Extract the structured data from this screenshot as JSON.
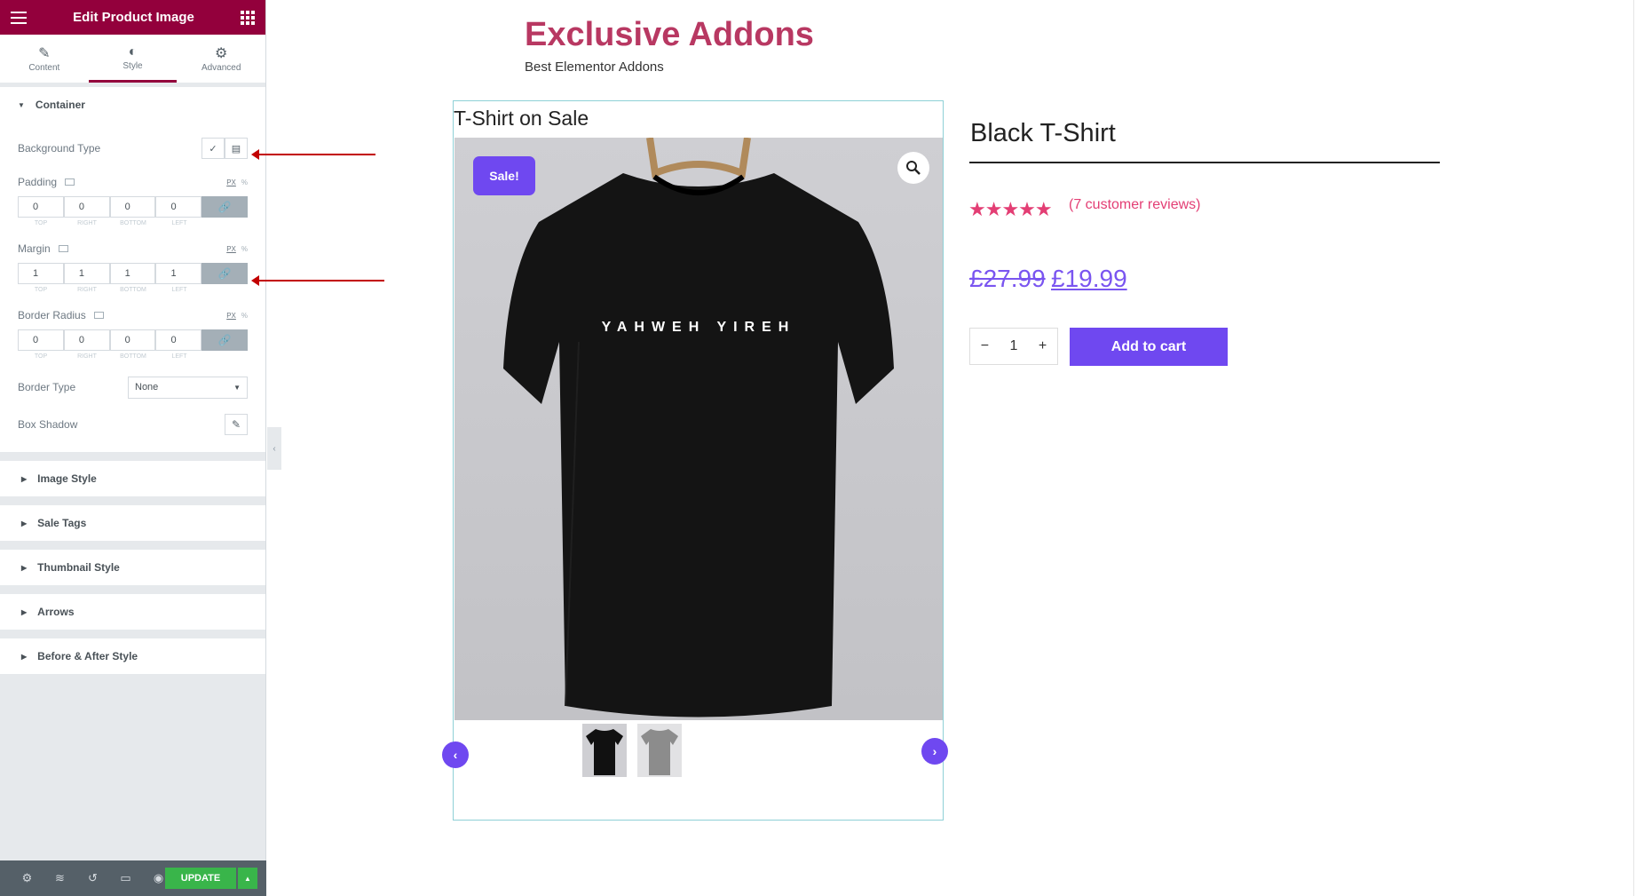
{
  "editor": {
    "title": "Edit Product Image",
    "tabs": [
      {
        "label": "Content",
        "icon": "pencil-icon"
      },
      {
        "label": "Style",
        "icon": "half-circle-icon"
      },
      {
        "label": "Advanced",
        "icon": "gear-icon"
      }
    ],
    "container": {
      "heading": "Container",
      "background_type": "Background Type",
      "padding": {
        "label": "Padding",
        "values": [
          "0",
          "0",
          "0",
          "0"
        ]
      },
      "margin": {
        "label": "Margin",
        "values": [
          "1",
          "1",
          "1",
          "1"
        ]
      },
      "border_radius": {
        "label": "Border Radius",
        "values": [
          "0",
          "0",
          "0",
          "0"
        ]
      },
      "dim_labels": [
        "TOP",
        "RIGHT",
        "BOTTOM",
        "LEFT"
      ],
      "unit_px": "PX",
      "unit_pct": "%",
      "border_type": {
        "label": "Border Type",
        "value": "None"
      },
      "box_shadow": "Box Shadow"
    },
    "sections": [
      "Image Style",
      "Sale Tags",
      "Thumbnail Style",
      "Arrows",
      "Before & After Style"
    ],
    "update_label": "UPDATE"
  },
  "preview": {
    "brand_title": "Exclusive Addons",
    "brand_subtitle": "Best Elementor Addons",
    "widget_title": "T-Shirt on Sale",
    "sale_badge": "Sale!",
    "shirt_print": "YAHWEH YIREH",
    "product_name": "Black T-Shirt",
    "rating_stars": "★★★★★",
    "rating_value": 4.5,
    "reviews": "(7 customer reviews)",
    "price_old": "£27.99",
    "price_new": "£19.99",
    "quantity": "1",
    "qty_minus": "−",
    "qty_plus": "+",
    "add_to_cart": "Add to cart"
  },
  "colors": {
    "editor_brand": "#93003c",
    "accent": "#6f48f0",
    "update_green": "#39b54a",
    "brand_title": "#b83862",
    "stars": "#e33e74"
  }
}
